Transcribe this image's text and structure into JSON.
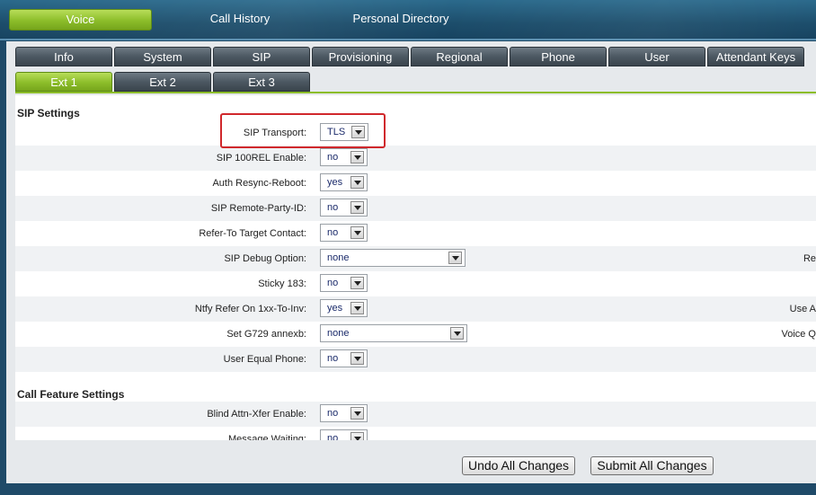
{
  "top_nav": [
    {
      "label": "Voice",
      "active": true
    },
    {
      "label": "Call History",
      "active": false
    },
    {
      "label": "Personal Directory",
      "active": false
    }
  ],
  "tabs": [
    {
      "label": "Info"
    },
    {
      "label": "System"
    },
    {
      "label": "SIP"
    },
    {
      "label": "Provisioning"
    },
    {
      "label": "Regional"
    },
    {
      "label": "Phone"
    },
    {
      "label": "User"
    },
    {
      "label": "Attendant Keys"
    }
  ],
  "subtabs": [
    {
      "label": "Ext 1",
      "active": true
    },
    {
      "label": "Ext 2",
      "active": false
    },
    {
      "label": "Ext 3",
      "active": false
    }
  ],
  "sections": {
    "sip_settings": "SIP Settings",
    "call_feature_settings": "Call Feature Settings"
  },
  "sip_rows": [
    {
      "label": "SIP Transport:",
      "value": "TLS"
    },
    {
      "label": "SIP 100REL Enable:",
      "value": "no"
    },
    {
      "label": "Auth Resync-Reboot:",
      "value": "yes"
    },
    {
      "label": "SIP Remote-Party-ID:",
      "value": "no"
    },
    {
      "label": "Refer-To Target Contact:",
      "value": "no"
    },
    {
      "label": "SIP Debug Option:",
      "value": "none",
      "right_clip": "Re"
    },
    {
      "label": "Sticky 183:",
      "value": "no"
    },
    {
      "label": "Ntfy Refer On 1xx-To-Inv:",
      "value": "yes",
      "right_clip": "Use A"
    },
    {
      "label": "Set G729 annexb:",
      "value": "none",
      "right_clip": "Voice Q"
    },
    {
      "label": "User Equal Phone:",
      "value": "no"
    }
  ],
  "call_rows": [
    {
      "label": "Blind Attn-Xfer Enable:",
      "value": "no"
    },
    {
      "label": "Message Waiting:",
      "value": "no"
    }
  ],
  "buttons": {
    "undo": "Undo All Changes",
    "submit": "Submit All Changes"
  },
  "colors": {
    "accent_green": "#8cbd2a",
    "highlight_red": "#d0282c",
    "nav_blue": "#1f4a68"
  }
}
